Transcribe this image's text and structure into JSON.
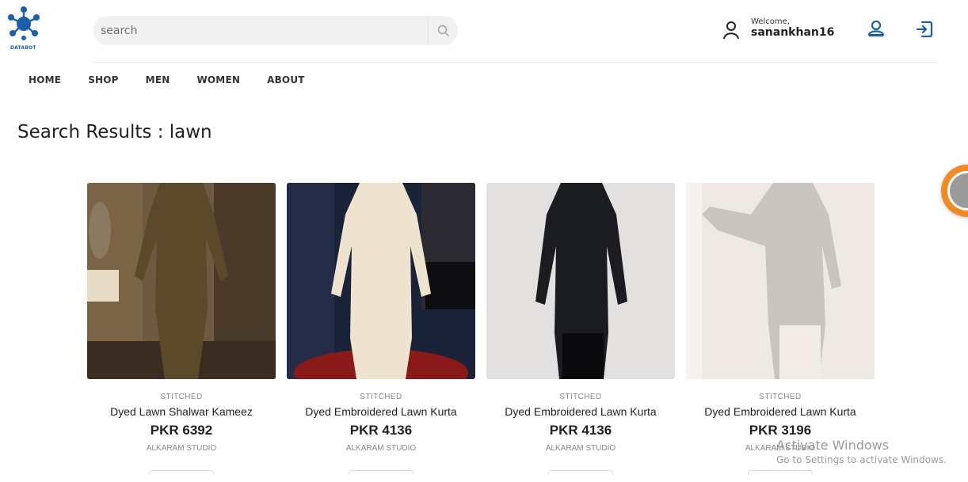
{
  "header": {
    "logo_text": "DATABOT",
    "search_placeholder": "search",
    "welcome_label": "Welcome,",
    "username": "sanankhan16"
  },
  "nav": {
    "items": [
      "HOME",
      "SHOP",
      "MEN",
      "WOMEN",
      "ABOUT"
    ]
  },
  "page": {
    "title": "Search Results : lawn"
  },
  "products": [
    {
      "category": "STITCHED",
      "name": "Dyed Lawn Shalwar Kameez",
      "price": "PKR 6392",
      "brand": "ALKARAM STUDIO",
      "color": "#5a4a2a"
    },
    {
      "category": "STITCHED",
      "name": "Dyed Embroidered Lawn Kurta",
      "price": "PKR 4136",
      "brand": "ALKARAM STUDIO",
      "color": "#eee3cf"
    },
    {
      "category": "STITCHED",
      "name": "Dyed Embroidered Lawn Kurta",
      "price": "PKR 4136",
      "brand": "ALKARAM STUDIO",
      "color": "#1b1c1f"
    },
    {
      "category": "STITCHED",
      "name": "Dyed Embroidered Lawn Kurta",
      "price": "PKR 3196",
      "brand": "ALKARAM STUDIO",
      "color": "#c9c6c2"
    }
  ],
  "watermark": {
    "title": "Activate Windows",
    "subtitle": "Go to Settings to activate Windows."
  },
  "colors": {
    "logo_blue": "#1a5fa8",
    "floating_button": "#f08a24"
  }
}
